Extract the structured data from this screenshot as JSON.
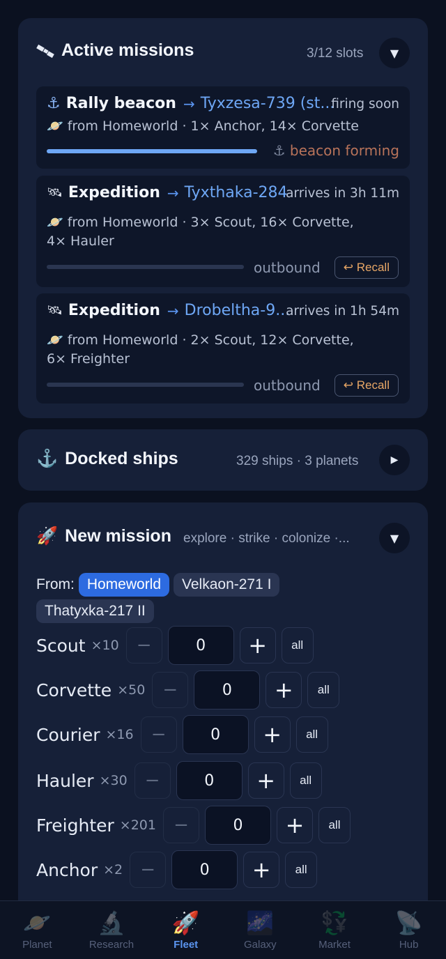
{
  "active_missions": {
    "icon": "satellite-icon",
    "title": "Active missions",
    "slots": "3/12 slots",
    "toggle": "▼",
    "missions": [
      {
        "icon": "⚓",
        "kind": "Rally beacon",
        "arrow": "→",
        "target": "Tyxzesa-739 (st...",
        "eta": "firing soon",
        "planet_icon": "🪐",
        "detail": "from Homeworld · 1× Anchor, 14× Corvette",
        "progress": 1.0,
        "status_icon": "⚓",
        "status": "beacon forming",
        "status_color": "#b8735a"
      },
      {
        "icon": "🛰",
        "kind": "Expedition",
        "arrow": "→",
        "target": "Tyxthaka-284",
        "eta": "arrives in 3h 11m",
        "planet_icon": "🪐",
        "detail": "from Homeworld · 3× Scout, 16× Corvette, 4× Hauler",
        "progress": 0.0,
        "status": "outbound",
        "recall": "↩ Recall"
      },
      {
        "icon": "🛰",
        "kind": "Expedition",
        "arrow": "→",
        "target": "Drobeltha-9...",
        "eta": "arrives in 1h 54m",
        "planet_icon": "🪐",
        "detail": "from Homeworld · 2× Scout, 12× Corvette, 6× Freighter",
        "progress": 0.0,
        "status": "outbound",
        "recall": "↩ Recall"
      }
    ]
  },
  "docked": {
    "icon": "⚓",
    "title": "Docked ships",
    "summary": "329 ships · 3 planets",
    "toggle": "▶"
  },
  "new_mission": {
    "icon": "🚀",
    "title": "New mission",
    "subtitle": "explore · strike · colonize ·...",
    "toggle": "▼",
    "from_label": "From:",
    "origins": [
      {
        "name": "Homeworld",
        "selected": true
      },
      {
        "name": "Velkaon-271 I",
        "selected": false
      },
      {
        "name": "Thatyxka-217 II",
        "selected": false
      }
    ],
    "ships": [
      {
        "name": "Scout",
        "count": "×10",
        "qty": "0"
      },
      {
        "name": "Corvette",
        "count": "×50",
        "qty": "0"
      },
      {
        "name": "Courier",
        "count": "×16",
        "qty": "0"
      },
      {
        "name": "Hauler",
        "count": "×30",
        "qty": "0"
      },
      {
        "name": "Freighter",
        "count": "×201",
        "qty": "0"
      },
      {
        "name": "Anchor",
        "count": "×2",
        "qty": "0"
      }
    ],
    "minus": "−",
    "plus": "+",
    "all": "all"
  },
  "tabs": [
    {
      "icon": "🪐",
      "label": "Planet",
      "active": false
    },
    {
      "icon": "🔬",
      "label": "Research",
      "active": false
    },
    {
      "icon": "🚀",
      "label": "Fleet",
      "active": true
    },
    {
      "icon": "🌌",
      "label": "Galaxy",
      "active": false
    },
    {
      "icon": "💱",
      "label": "Market",
      "active": false
    },
    {
      "icon": "📡",
      "label": "Hub",
      "active": false
    }
  ]
}
